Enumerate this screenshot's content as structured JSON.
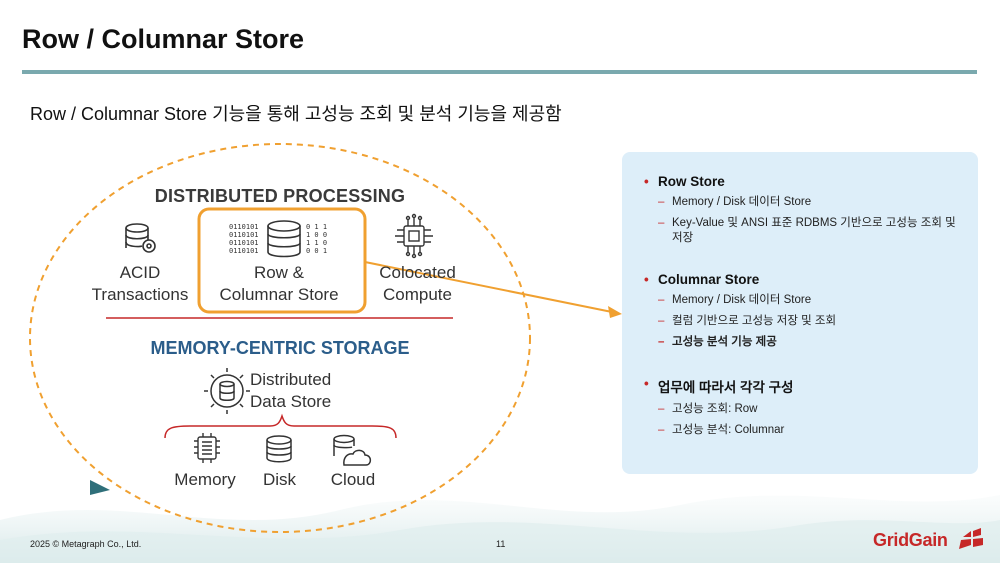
{
  "slide": {
    "title": "Row / Columnar Store",
    "subtitle": "Row / Columnar Store 기능을 통해 고성능 조회 및 분석 기능을 제공함"
  },
  "diagram": {
    "distributed_heading": "DISTRIBUTED PROCESSING",
    "acid_line1": "ACID",
    "acid_line2": "Transactions",
    "rc_line1": "Row &",
    "rc_line2": "Columnar Store",
    "colo_line1": "Colocated",
    "colo_line2": "Compute",
    "memory_heading": "MEMORY-CENTRIC STORAGE",
    "dds_line1": "Distributed",
    "dds_line2": "Data Store",
    "memory_label": "Memory",
    "disk_label": "Disk",
    "cloud_label": "Cloud",
    "binary_lines": [
      "0110101",
      "0110101",
      "0110101",
      "0110101"
    ],
    "bits_lines": [
      "0 1 1",
      "1 0 0",
      "1 1 0",
      "0 0 1"
    ],
    "colors": {
      "accent_orange": "#f0a030",
      "divider_red": "#c62828",
      "heading_blue": "#2b5d8a"
    }
  },
  "panel": {
    "sections": [
      {
        "heading": "Row Store",
        "items": [
          {
            "text": "Memory / Disk 데이터 Store",
            "bold": false
          },
          {
            "text": "Key-Value 및 ANSI 표준 RDBMS 기반으로 고성능 조회 및 저장",
            "bold": false
          }
        ]
      },
      {
        "heading": "Columnar Store",
        "items": [
          {
            "text": "Memory / Disk 데이터 Store",
            "bold": false
          },
          {
            "text": "컬럼 기반으로 고성능 저장 및 조회",
            "bold": false
          },
          {
            "text": "고성능 분석 기능 제공",
            "bold": true
          }
        ]
      },
      {
        "heading": "업무에 따라서 각각 구성",
        "items": [
          {
            "text": "고성능 조회: Row",
            "bold": false
          },
          {
            "text": "고성능 분석: Columnar",
            "bold": false
          }
        ]
      }
    ],
    "bullet": "•",
    "dash": "–",
    "background": "#ddeef9"
  },
  "footer": {
    "copyright": "2025 © Metagraph Co., Ltd.",
    "page_number": "11",
    "logo_text": "GridGain"
  }
}
